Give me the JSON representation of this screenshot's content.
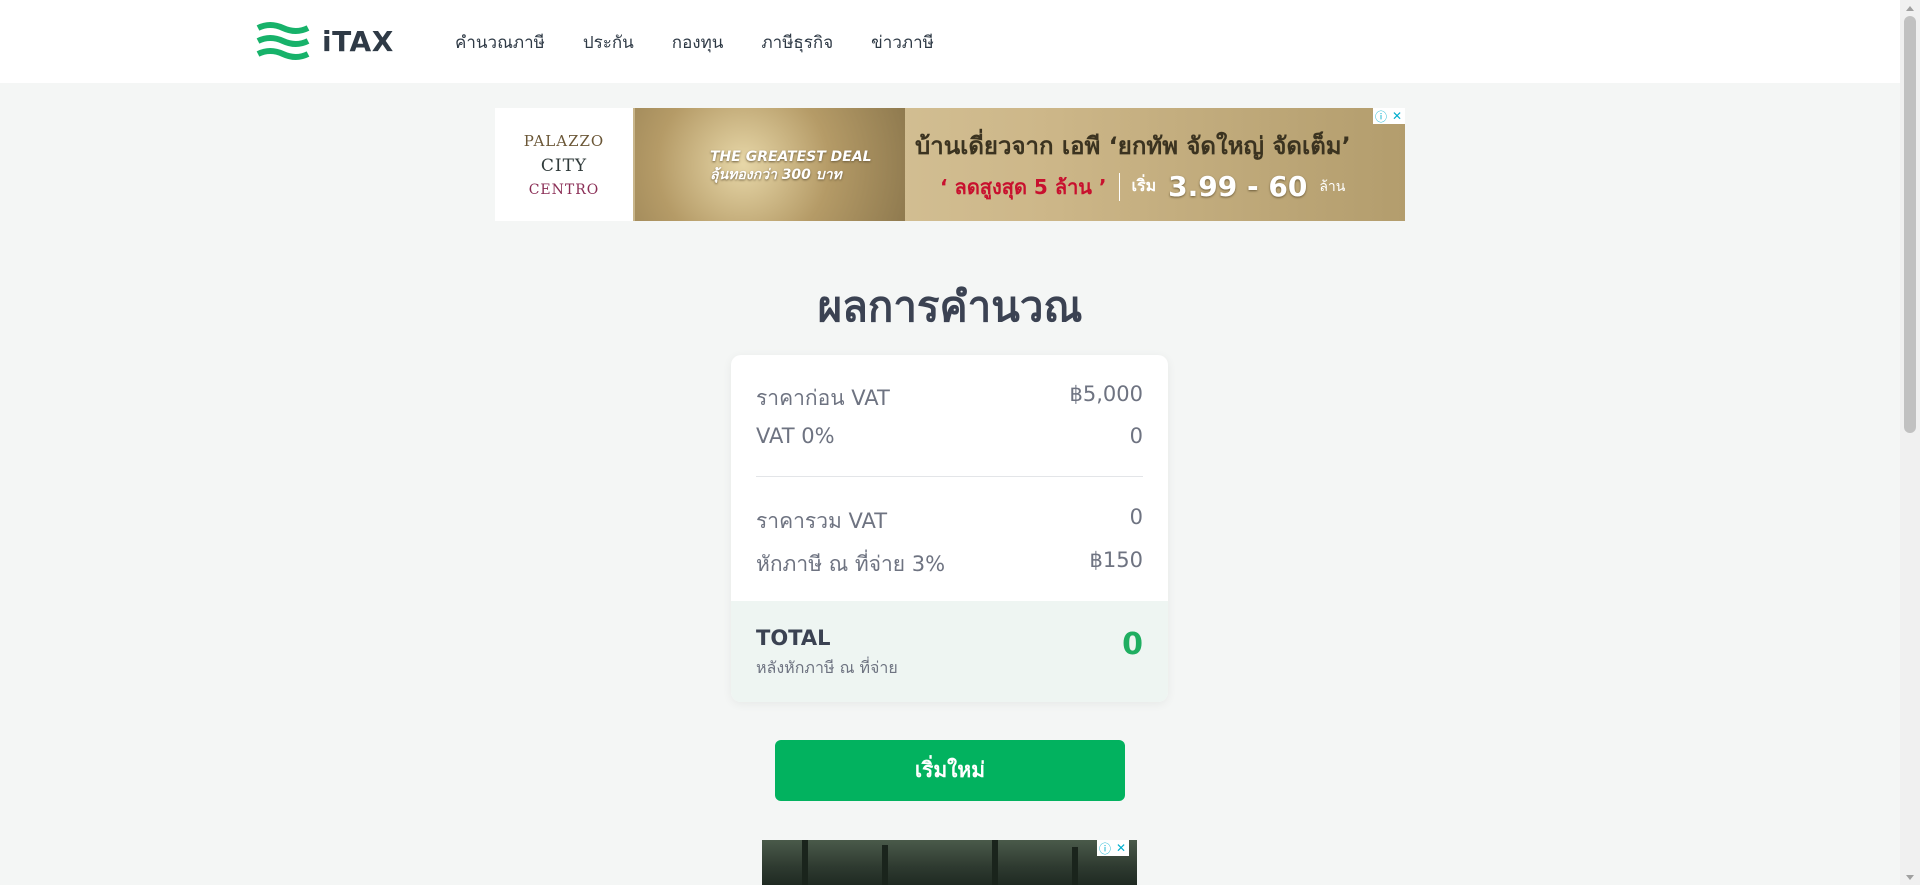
{
  "header": {
    "logo_text": "iTAX",
    "nav": [
      "คำนวณภาษี",
      "ประกัน",
      "กองทุน",
      "ภาษีธุรกิจ",
      "ข่าวภาษี"
    ]
  },
  "ad_top": {
    "brand_1": "PALAZZO",
    "brand_2": "CITY",
    "brand_3": "CENTRO",
    "tagline_1": "THE GREATEST DEAL",
    "tagline_2": "ลุ้นทองกว่า 300 บาท",
    "headline": "บ้านเดี่ยวจาก เอพี ‘ยกทัพ จัดใหญ่ จัดเต็ม’",
    "discount": "‘ ลดสูงสุด 5 ล้าน ’",
    "price_label": "เริ่ม",
    "price_range": "3.99 - 60",
    "price_unit": "ล้าน"
  },
  "main": {
    "title": "ผลการคำนวณ",
    "rows": [
      {
        "label": "ราคาก่อน VAT",
        "value": "฿5,000"
      },
      {
        "label": "VAT 0%",
        "value": "0"
      },
      {
        "label": "ราคารวม VAT",
        "value": "0"
      },
      {
        "label": "หักภาษี ณ ที่จ่าย 3%",
        "value": "฿150"
      }
    ],
    "total": {
      "label": "TOTAL",
      "sublabel": "หลังหักภาษี ณ ที่จ่าย",
      "value": "0"
    },
    "reset_button": "เริ่มใหม่"
  },
  "colors": {
    "brand_green": "#02b25f",
    "total_value": "#1fae61",
    "background": "#f4f6f5"
  },
  "icons": {
    "logo": "itax-waves-logo",
    "ad_info": "info-icon",
    "ad_close": "close-icon"
  }
}
